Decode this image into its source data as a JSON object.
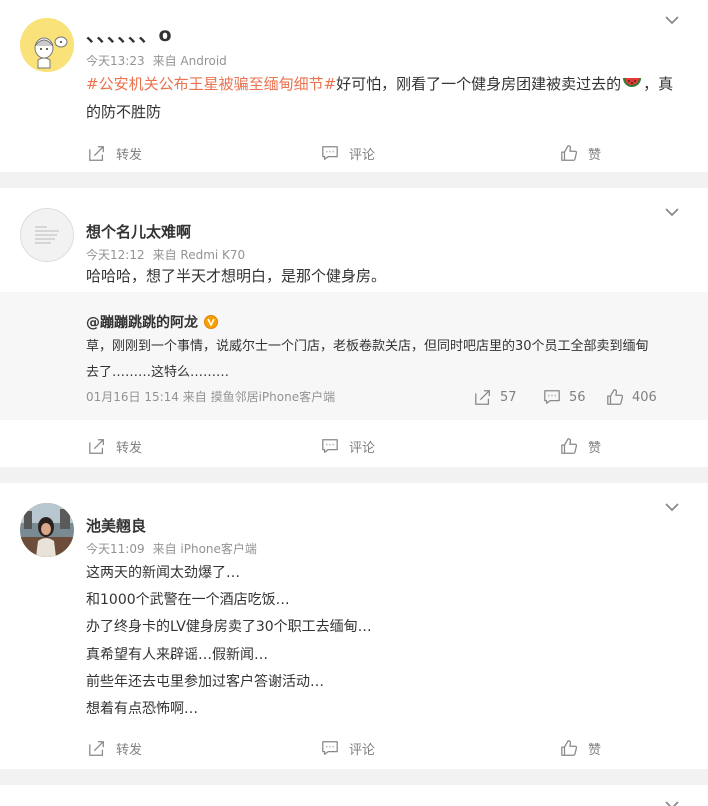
{
  "posts": [
    {
      "username": "、、、、、、o",
      "time": "今天13:23",
      "source": "来自 Android",
      "topic": "#公安机关公布王星被骗至缅甸细节#",
      "text_after_topic": "好可怕，刚看了一个健身房团建被卖过去的",
      "text_tail": "，真的防不胜防",
      "actions": {
        "repost": "转发",
        "comment": "评论",
        "like": "赞"
      }
    },
    {
      "username": "想个名儿太难啊",
      "time": "今天12:12",
      "source": "来自 Redmi K70",
      "text": "哈哈哈，想了半天才想明白，是那个健身房。",
      "quote": {
        "username": "@蹦蹦跳跳的阿龙",
        "text_line1": "草，刚刚到一个事情，说威尔士一个门店，老板卷款关店，但同时吧店里的30个员工全部卖到缅甸",
        "text_line2": "去了………这特么………",
        "time": "01月16日 15:14",
        "source": "来自 摸鱼邻居iPhone客户端",
        "reposts": "57",
        "comments": "56",
        "likes": "406"
      },
      "actions": {
        "repost": "转发",
        "comment": "评论",
        "like": "赞"
      }
    },
    {
      "username": "池美翹良",
      "time": "今天11:09",
      "source": "来自 iPhone客户端",
      "lines": [
        "这两天的新闻太劲爆了…",
        "和1000个武警在一个酒店吃饭…",
        "办了终身卡的LV健身房卖了30个职工去缅甸…",
        "真希望有人来辟谣…假新闻…",
        "前些年还去屯里参加过客户答谢活动…",
        "想着有点恐怖啊…"
      ],
      "actions": {
        "repost": "转发",
        "comment": "评论",
        "like": "赞"
      }
    }
  ],
  "colors": {
    "topic": "#eb7350",
    "meta": "#939393",
    "page_bg": "#f2f2f2"
  }
}
